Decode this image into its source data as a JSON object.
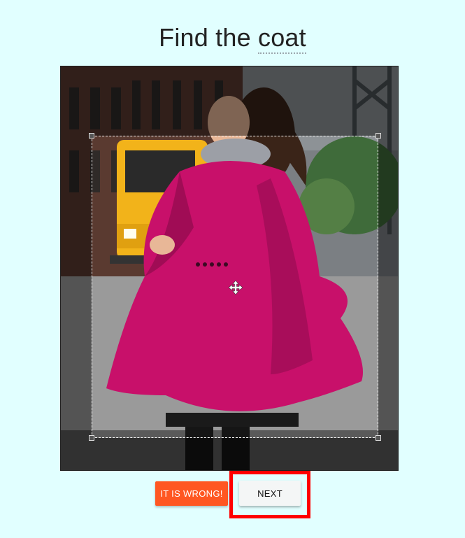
{
  "title": {
    "prefix": "Find the",
    "keyword": "coat"
  },
  "photo": {
    "subject": "woman wearing magenta coat on city street with school bus"
  },
  "crop": {
    "handle_icon": "move-icon"
  },
  "buttons": {
    "wrong_label": "IT IS WRONG!",
    "next_label": "NEXT"
  },
  "colors": {
    "background": "#e1ffff",
    "wrong_button": "#ff5722",
    "highlight": "#ff0000",
    "coat": "#c8106a"
  }
}
